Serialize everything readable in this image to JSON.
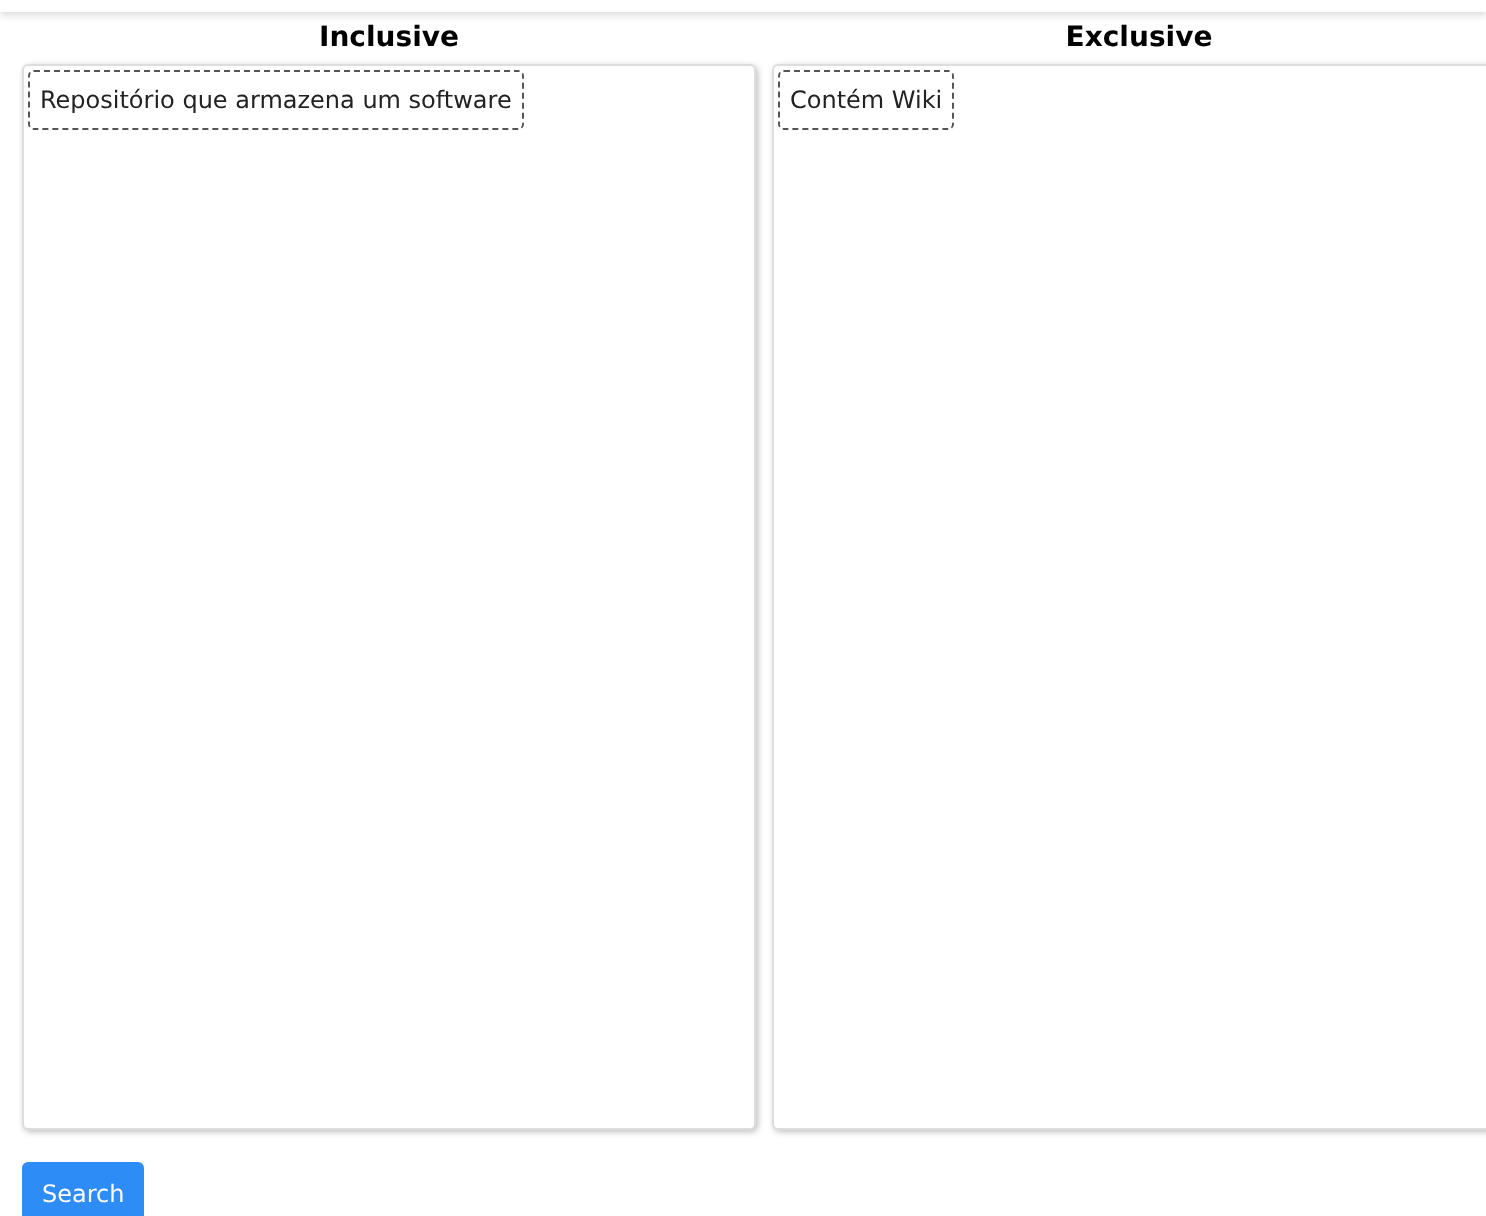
{
  "lists": [
    {
      "title": "Inclusive",
      "items": [
        "Repositório que armazena um software"
      ]
    },
    {
      "title": "Exclusive",
      "items": [
        "Contém Wiki"
      ]
    }
  ],
  "search_button": "Search"
}
